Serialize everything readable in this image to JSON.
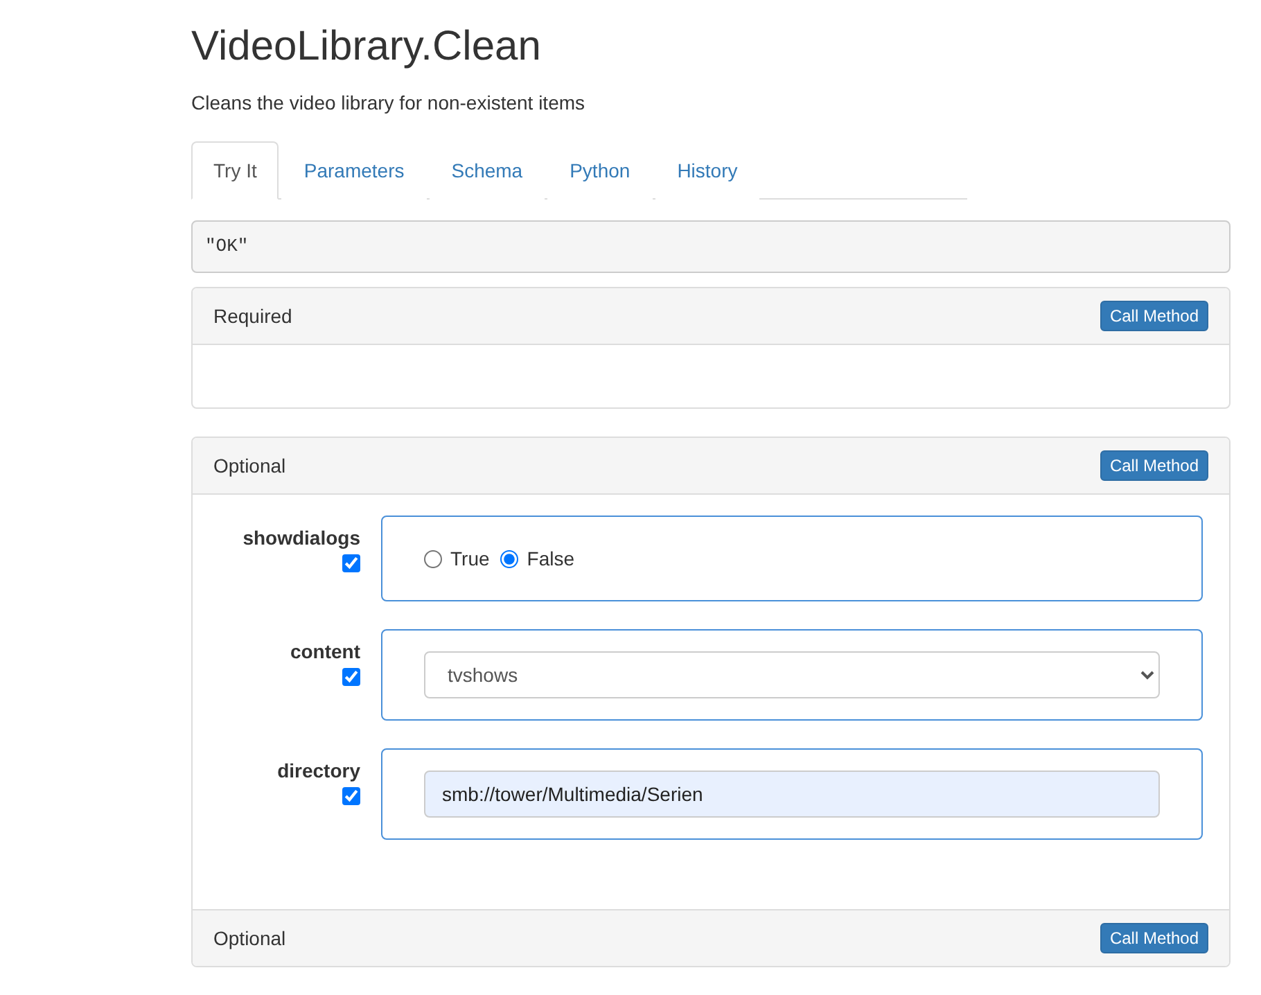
{
  "title": "VideoLibrary.Clean",
  "description": "Cleans the video library for non-existent items",
  "tabs": [
    {
      "label": "Try It",
      "selected": true
    },
    {
      "label": "Parameters",
      "selected": false
    },
    {
      "label": "Schema",
      "selected": false
    },
    {
      "label": "Python",
      "selected": false
    },
    {
      "label": "History",
      "selected": false
    }
  ],
  "result": "\"OK\"",
  "required_panel": {
    "title": "Required",
    "button": "Call Method"
  },
  "optional_panel": {
    "title": "Optional",
    "button": "Call Method",
    "footer_title": "Optional",
    "footer_button": "Call Method",
    "params": [
      {
        "name": "showdialogs",
        "enabled": true,
        "kind": "radio",
        "options": [
          {
            "label": "True",
            "selected": false
          },
          {
            "label": "False",
            "selected": true
          }
        ]
      },
      {
        "name": "content",
        "enabled": true,
        "kind": "select",
        "value": "tvshows"
      },
      {
        "name": "directory",
        "enabled": true,
        "kind": "text",
        "value": "smb://tower/Multimedia/Serien"
      }
    ]
  }
}
